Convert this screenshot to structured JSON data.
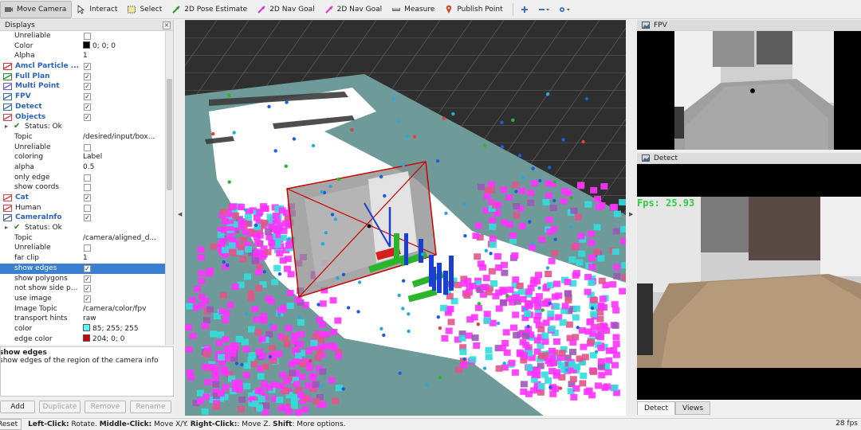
{
  "toolbar": {
    "tools": [
      {
        "label": "Move Camera",
        "icon": "move-camera-icon",
        "active": true
      },
      {
        "label": "Interact",
        "icon": "interact-icon"
      },
      {
        "label": "Select",
        "icon": "select-icon"
      },
      {
        "label": "2D Pose Estimate",
        "icon": "pose-estimate-icon"
      },
      {
        "label": "2D Nav Goal",
        "icon": "nav-goal-icon"
      },
      {
        "label": "2D Nav Goal",
        "icon": "nav-goal-icon"
      },
      {
        "label": "Measure",
        "icon": "measure-icon"
      },
      {
        "label": "Publish Point",
        "icon": "publish-point-icon"
      }
    ]
  },
  "displays": {
    "title": "Displays",
    "rows": [
      {
        "name": "Unreliable",
        "kind": "prop",
        "check": false
      },
      {
        "name": "Color",
        "kind": "prop",
        "value": "0; 0; 0",
        "swatch": "#000000"
      },
      {
        "name": "Alpha",
        "kind": "prop",
        "value": "1"
      },
      {
        "name": "Amcl Particle ...",
        "kind": "display",
        "check": true,
        "iconColor": "#cc3333"
      },
      {
        "name": "Full Plan",
        "kind": "display",
        "check": true,
        "iconColor": "#2e8b2e"
      },
      {
        "name": "Multi Point",
        "kind": "display",
        "check": true,
        "iconColor": "#6a5acd"
      },
      {
        "name": "FPV",
        "kind": "display",
        "check": true,
        "iconColor": "#3a6ea5"
      },
      {
        "name": "Detect",
        "kind": "display",
        "check": true,
        "iconColor": "#3a6ea5"
      },
      {
        "name": "Objects",
        "kind": "display",
        "check": true,
        "iconColor": "#cc4444"
      },
      {
        "name": "Status: Ok",
        "kind": "status"
      },
      {
        "name": "Topic",
        "kind": "prop",
        "value": "/desired/input/box..."
      },
      {
        "name": "Unreliable",
        "kind": "prop",
        "check": false
      },
      {
        "name": "coloring",
        "kind": "prop",
        "value": "Label"
      },
      {
        "name": "alpha",
        "kind": "prop",
        "value": "0.5"
      },
      {
        "name": "only edge",
        "kind": "prop",
        "check": false
      },
      {
        "name": "show coords",
        "kind": "prop",
        "check": false
      },
      {
        "name": "Cat",
        "kind": "display",
        "check": true,
        "iconColor": "#cc4444"
      },
      {
        "name": "Human",
        "kind": "display-plain",
        "check": false,
        "iconColor": "#cc4444"
      },
      {
        "name": "CameraInfo",
        "kind": "display",
        "check": true,
        "iconColor": "#4a6a8a"
      },
      {
        "name": "Status: Ok",
        "kind": "status"
      },
      {
        "name": "Topic",
        "kind": "prop",
        "value": "/camera/aligned_d..."
      },
      {
        "name": "Unreliable",
        "kind": "prop",
        "check": false
      },
      {
        "name": "far clip",
        "kind": "prop",
        "value": "1"
      },
      {
        "name": "show edges",
        "kind": "prop",
        "check": true,
        "selected": true
      },
      {
        "name": "show polygons",
        "kind": "prop",
        "check": true
      },
      {
        "name": "not show side p...",
        "kind": "prop",
        "check": true
      },
      {
        "name": "use image",
        "kind": "prop",
        "check": true
      },
      {
        "name": "Image Topic",
        "kind": "prop",
        "value": "/camera/color/fpv"
      },
      {
        "name": "transport hints",
        "kind": "prop",
        "value": "raw"
      },
      {
        "name": "color",
        "kind": "prop",
        "value": "85; 255; 255",
        "swatch": "#55ffff"
      },
      {
        "name": "edge color",
        "kind": "prop",
        "value": "204; 0; 0",
        "swatch": "#cc0000"
      }
    ]
  },
  "description": {
    "title": "show edges",
    "text": "show edges of the region of the camera info"
  },
  "buttons": {
    "add": "Add",
    "duplicate": "Duplicate",
    "remove": "Remove",
    "rename": "Rename"
  },
  "panels": {
    "fpv_title": "FPV",
    "detect_title": "Detect",
    "fps_overlay": "Fps:  25.93"
  },
  "tabs": {
    "detect": "Detect",
    "views": "Views"
  },
  "status": {
    "reset": "Reset",
    "hint_parts": [
      {
        "b": "Left-Click:",
        "t": " Rotate. "
      },
      {
        "b": "Middle-Click:",
        "t": " Move X/Y. "
      },
      {
        "b": "Right-Click:",
        "t": ": Move Z. "
      },
      {
        "b": "Shift",
        "t": ": More options."
      }
    ],
    "fps": "28 fps"
  },
  "colors": {
    "selection": "#3b7fd0",
    "display_name": "#2b64b6",
    "fps_overlay": "#2ecc40",
    "costmap_magenta": "#ff33ff",
    "costmap_cyan": "#33dddd"
  }
}
